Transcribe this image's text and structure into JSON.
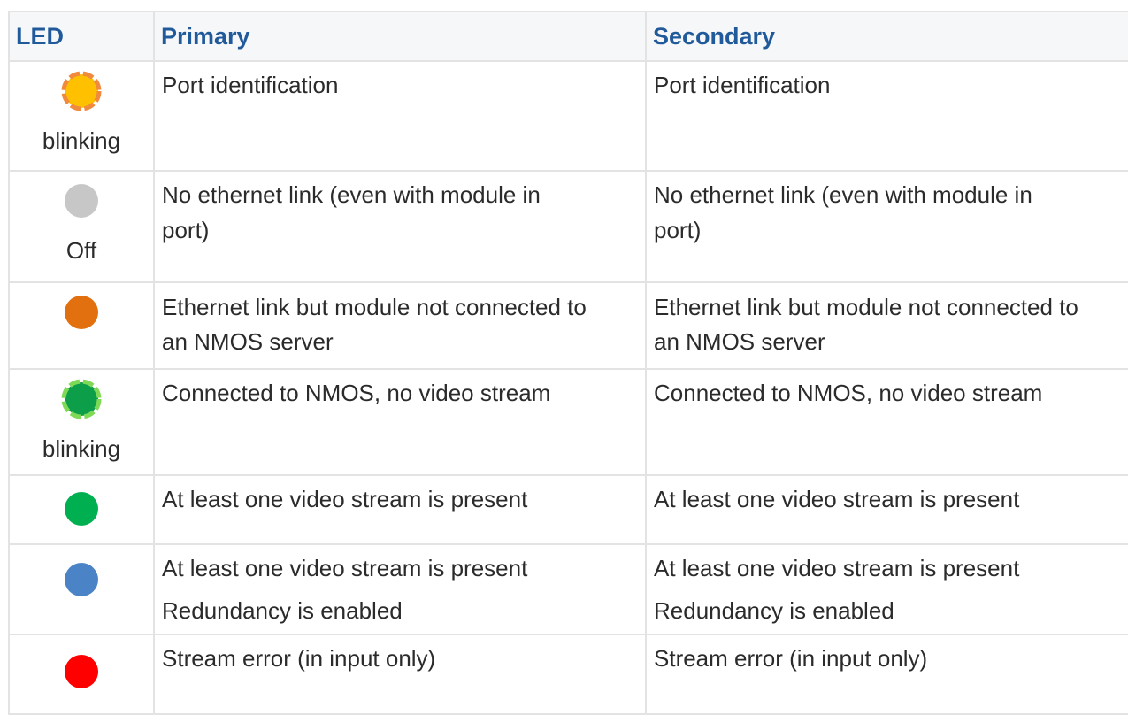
{
  "table": {
    "headers": {
      "led": "LED",
      "primary": "Primary",
      "secondary": "Secondary"
    },
    "rows": [
      {
        "led_color": "#ffc000",
        "led_ring": "#f08a3c",
        "led_caption": "blinking",
        "blinking": true,
        "primary": [
          "Port identification"
        ],
        "secondary": [
          "Port identification"
        ]
      },
      {
        "led_color": "#c7c7c7",
        "led_caption": "Off",
        "blinking": false,
        "primary": [
          "No ethernet link (even with module in",
          "port)"
        ],
        "secondary": [
          "No ethernet link (even with module in",
          "port)"
        ]
      },
      {
        "led_color": "#e2700e",
        "led_caption": "",
        "blinking": false,
        "primary": [
          "Ethernet link but module not connected to",
          "an NMOS server"
        ],
        "secondary": [
          "Ethernet link but module not connected to",
          "an NMOS server"
        ]
      },
      {
        "led_color": "#0d9e4a",
        "led_ring": "#7ed957",
        "led_caption": "blinking",
        "blinking": true,
        "primary": [
          "Connected to NMOS, no video stream"
        ],
        "secondary": [
          "Connected to NMOS, no video stream"
        ]
      },
      {
        "led_color": "#00b050",
        "led_caption": "",
        "blinking": false,
        "primary": [
          "At least one video stream is present"
        ],
        "secondary": [
          "At least one video stream is present"
        ]
      },
      {
        "led_color": "#4a84c6",
        "led_caption": "",
        "blinking": false,
        "primary": [
          "At least one video stream is present",
          "Redundancy is enabled"
        ],
        "secondary": [
          "At least one video stream is present",
          "Redundancy is enabled"
        ]
      },
      {
        "led_color": "#ff0000",
        "led_caption": "",
        "blinking": false,
        "primary": [
          "Stream error (in input only)"
        ],
        "secondary": [
          "Stream error (in input only)"
        ]
      }
    ]
  }
}
